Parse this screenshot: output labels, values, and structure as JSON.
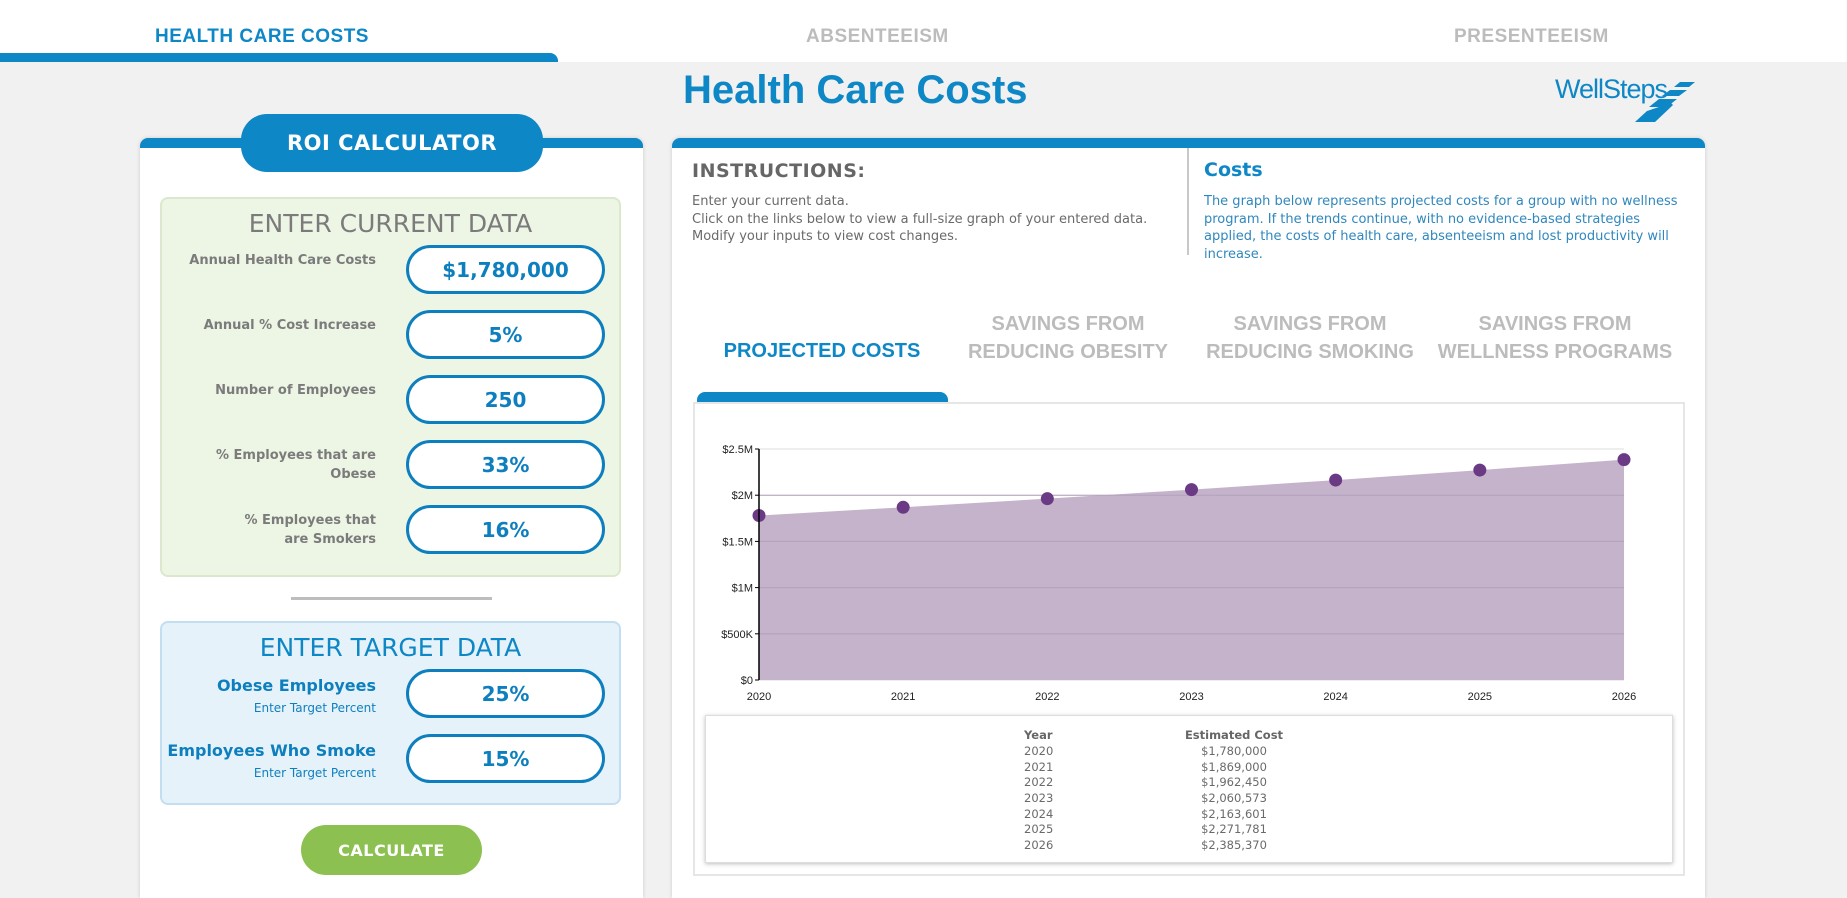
{
  "topnav": {
    "tabs": [
      {
        "label": "HEALTH CARE COSTS",
        "active": true
      },
      {
        "label": "ABSENTEEISM",
        "active": false
      },
      {
        "label": "PRESENTEEISM",
        "active": false
      }
    ]
  },
  "header": {
    "title": "Health Care Costs",
    "logo_text": "WellSteps"
  },
  "calculator": {
    "badge": "ROI CALCULATOR",
    "current": {
      "title": "ENTER CURRENT DATA",
      "fields": [
        {
          "label": "Annual Health Care Costs",
          "value": "$1,780,000"
        },
        {
          "label": "Annual % Cost Increase",
          "value": "5%"
        },
        {
          "label": "Number of Employees",
          "value": "250"
        },
        {
          "label": "% Employees that are Obese",
          "value": "33%"
        },
        {
          "label": "% Employees that are Smokers",
          "value": "16%"
        }
      ]
    },
    "target": {
      "title": "ENTER TARGET DATA",
      "fields": [
        {
          "label": "Obese Employees",
          "sublabel": "Enter Target Percent",
          "value": "25%"
        },
        {
          "label": "Employees Who Smoke",
          "sublabel": "Enter Target Percent",
          "value": "15%"
        }
      ]
    },
    "calculate_label": "CALCULATE"
  },
  "instructions": {
    "title": "INSTRUCTIONS:",
    "lines": [
      "Enter your current data.",
      "Click on the links below to view a full-size graph of your entered data.",
      "Modify your inputs to view cost changes."
    ]
  },
  "costs_info": {
    "title": "Costs",
    "text": "The graph below represents projected costs for a group with no wellness program. If the trends continue, with no evidence-based strategies applied, the costs of health care, absenteeism and lost productivity will increase."
  },
  "chart_tabs": [
    {
      "label": "PROJECTED COSTS",
      "active": true
    },
    {
      "label": "SAVINGS FROM REDUCING OBESITY",
      "active": false
    },
    {
      "label": "SAVINGS FROM REDUCING SMOKING",
      "active": false
    },
    {
      "label": "SAVINGS FROM WELLNESS PROGRAMS",
      "active": false
    }
  ],
  "colors": {
    "brand_blue": "#0e87c6",
    "area_fill": "#c5b3cc",
    "point": "#6b3a85",
    "calculate_green": "#8cc152"
  },
  "chart_data": {
    "type": "area",
    "title": "",
    "xlabel": "",
    "ylabel": "",
    "x": [
      "2020",
      "2021",
      "2022",
      "2023",
      "2024",
      "2025",
      "2026"
    ],
    "series": [
      {
        "name": "Estimated Cost",
        "values": [
          1780000,
          1869000,
          1962450,
          2060573,
          2163601,
          2271781,
          2385370
        ]
      }
    ],
    "ylim": [
      0,
      2500000
    ],
    "yticks": [
      0,
      500000,
      1000000,
      1500000,
      2000000,
      2500000
    ],
    "ytick_labels": [
      "$0",
      "$500K",
      "$1M",
      "$1.5M",
      "$2M",
      "$2.5M"
    ],
    "grid": true,
    "legend": "none"
  },
  "table": {
    "headers": [
      "Year",
      "Estimated Cost"
    ],
    "rows": [
      [
        "2020",
        "$1,780,000"
      ],
      [
        "2021",
        "$1,869,000"
      ],
      [
        "2022",
        "$1,962,450"
      ],
      [
        "2023",
        "$2,060,573"
      ],
      [
        "2024",
        "$2,163,601"
      ],
      [
        "2025",
        "$2,271,781"
      ],
      [
        "2026",
        "$2,385,370"
      ]
    ]
  }
}
